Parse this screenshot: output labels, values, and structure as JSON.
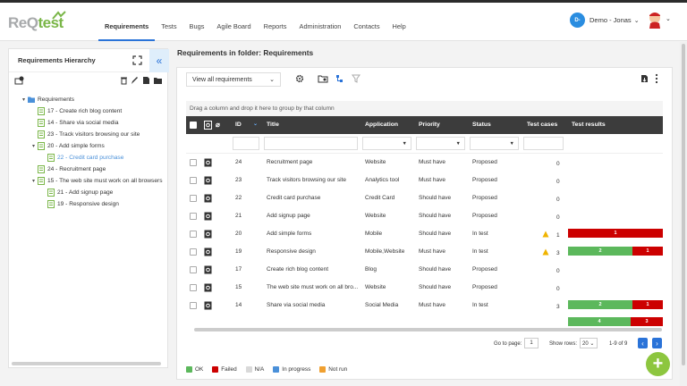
{
  "app": {
    "logo_text_a": "ReQ",
    "logo_text_b": "test"
  },
  "nav": [
    "Requirements",
    "Tests",
    "Bugs",
    "Agile Board",
    "Reports",
    "Administration",
    "Contacts",
    "Help"
  ],
  "user": {
    "initials": "D-",
    "name": "Demo - Jonas"
  },
  "hierarchy": {
    "title": "Requirements Hierarchy",
    "items": [
      {
        "label": "Requirements",
        "level": 0,
        "type": "folder",
        "toggle": "▾"
      },
      {
        "label": "17 - Create rich blog content",
        "level": 1,
        "type": "file",
        "toggle": ""
      },
      {
        "label": "14 - Share via social media",
        "level": 1,
        "type": "file",
        "toggle": ""
      },
      {
        "label": "23 - Track visitors browsing our site",
        "level": 1,
        "type": "file",
        "toggle": ""
      },
      {
        "label": "20 - Add simple forms",
        "level": 1,
        "type": "file",
        "toggle": "▾"
      },
      {
        "label": "22 - Credit card purchase",
        "level": 2,
        "type": "file",
        "toggle": "",
        "selected": true
      },
      {
        "label": "24 - Recruitment page",
        "level": 1,
        "type": "file",
        "toggle": ""
      },
      {
        "label": "15 - The web site must work on all browsers",
        "level": 1,
        "type": "file",
        "toggle": "▾"
      },
      {
        "label": "21 - Add signup page",
        "level": 2,
        "type": "file",
        "toggle": ""
      },
      {
        "label": "19 - Responsive design",
        "level": 2,
        "type": "file",
        "toggle": ""
      }
    ]
  },
  "main": {
    "title": "Requirements in folder: Requirements",
    "view_select": "View all requirements",
    "group_hint": "Drag a column and drop it here to group by that column",
    "columns": [
      "ID",
      "Title",
      "Application",
      "Priority",
      "Status",
      "Test cases",
      "Test results"
    ],
    "rows": [
      {
        "id": "24",
        "title": "Recruitment page",
        "app": "Website",
        "priority": "Must have",
        "status": "Proposed",
        "tc": "0",
        "warn": false,
        "results": []
      },
      {
        "id": "23",
        "title": "Track visitors browsing our site",
        "app": "Analytics tool",
        "priority": "Must have",
        "status": "Proposed",
        "tc": "0",
        "warn": false,
        "results": []
      },
      {
        "id": "22",
        "title": "Credit card purchase",
        "app": "Credit Card",
        "priority": "Should have",
        "status": "Proposed",
        "tc": "0",
        "warn": false,
        "results": []
      },
      {
        "id": "21",
        "title": "Add signup page",
        "app": "Website",
        "priority": "Should have",
        "status": "Proposed",
        "tc": "0",
        "warn": false,
        "results": []
      },
      {
        "id": "20",
        "title": "Add simple forms",
        "app": "Mobile",
        "priority": "Should have",
        "status": "In test",
        "tc": "1",
        "warn": true,
        "results": [
          {
            "label": "1",
            "color": "#cc0000",
            "frac": 1.0
          }
        ]
      },
      {
        "id": "19",
        "title": "Responsive design",
        "app": "Mobile,Website",
        "priority": "Must have",
        "status": "In test",
        "tc": "3",
        "warn": true,
        "results": [
          {
            "label": "2",
            "color": "#5cb85c",
            "frac": 0.68
          },
          {
            "label": "1",
            "color": "#cc0000",
            "frac": 0.32
          }
        ]
      },
      {
        "id": "17",
        "title": "Create rich blog content",
        "app": "Blog",
        "priority": "Should have",
        "status": "Proposed",
        "tc": "0",
        "warn": false,
        "results": []
      },
      {
        "id": "15",
        "title": "The web site must work on all bro...",
        "app": "Website",
        "priority": "Should have",
        "status": "Proposed",
        "tc": "0",
        "warn": false,
        "results": []
      },
      {
        "id": "14",
        "title": "Share via social media",
        "app": "Social Media",
        "priority": "Must have",
        "status": "In test",
        "tc": "3",
        "warn": false,
        "results": [
          {
            "label": "2",
            "color": "#5cb85c",
            "frac": 0.68
          },
          {
            "label": "1",
            "color": "#cc0000",
            "frac": 0.32
          }
        ]
      }
    ],
    "summary_results": [
      {
        "label": "4",
        "color": "#5cb85c",
        "frac": 0.66
      },
      {
        "label": "3",
        "color": "#cc0000",
        "frac": 0.34
      }
    ],
    "pager": {
      "go_to_label": "Go to page:",
      "page": "1",
      "show_rows_label": "Show rows:",
      "rows": "20",
      "range": "1-9 of 9"
    }
  },
  "legend": [
    {
      "label": "OK",
      "color": "#5cb85c"
    },
    {
      "label": "Failed",
      "color": "#cc0000"
    },
    {
      "label": "N/A",
      "color": "#d9d9d9"
    },
    {
      "label": "In progress",
      "color": "#4a90d9"
    },
    {
      "label": "Not run",
      "color": "#f0a030"
    }
  ]
}
